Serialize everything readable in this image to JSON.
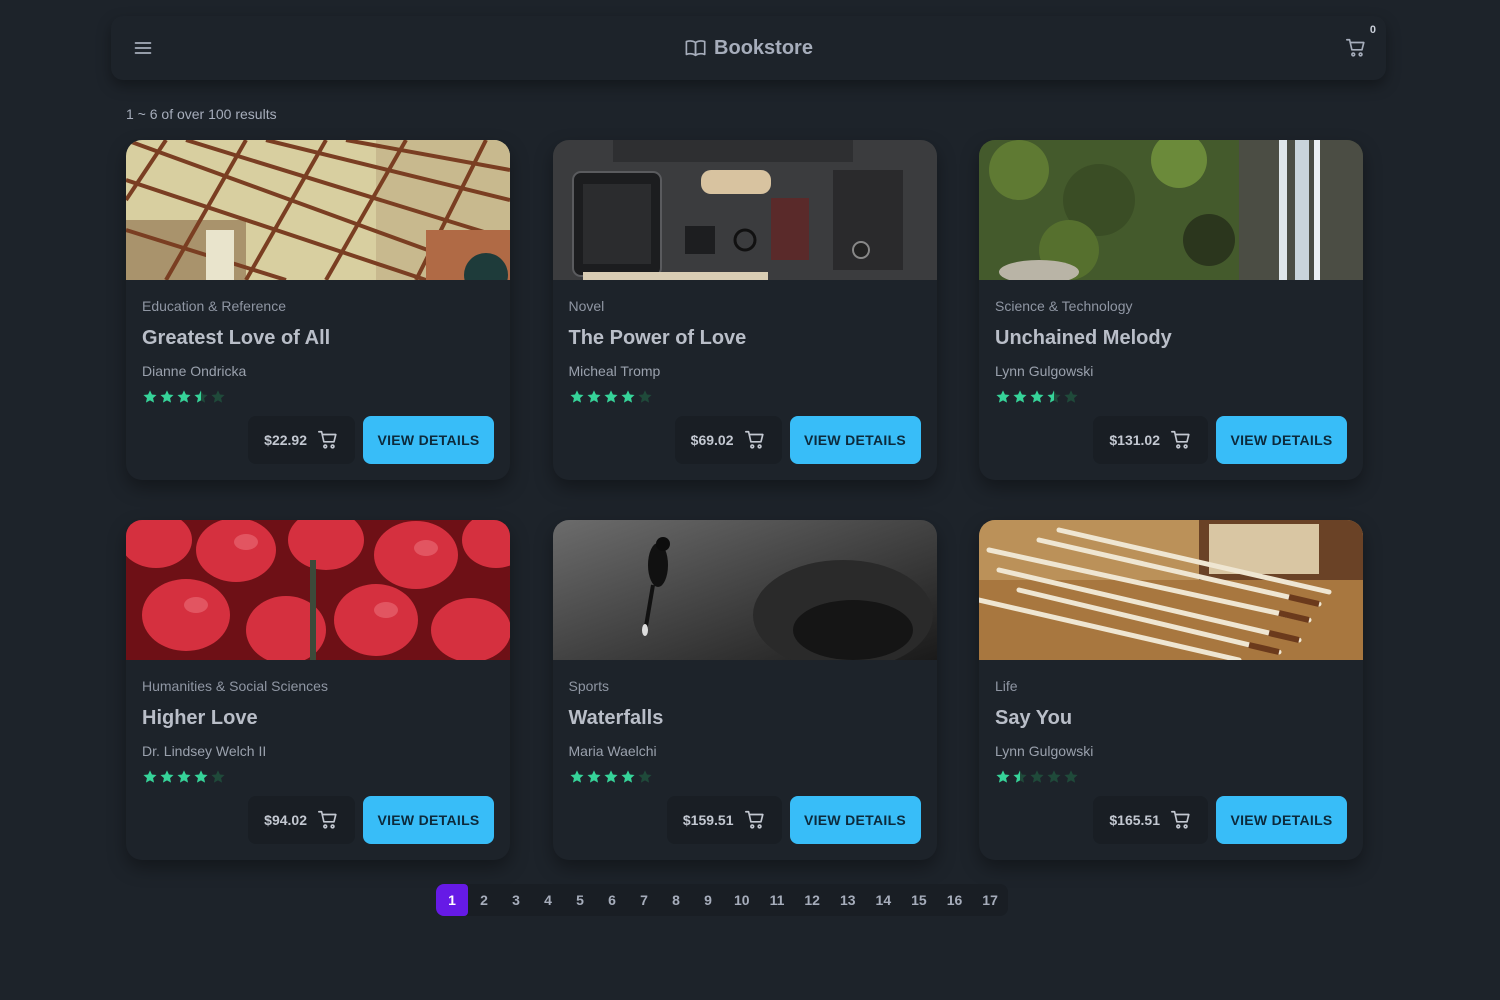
{
  "navbar": {
    "brand": "Bookstore",
    "cart_count": "0",
    "icons": {
      "menu": "hamburger-icon",
      "brand": "book-open-icon",
      "cart": "shopping-cart-icon"
    }
  },
  "results_text": "1 ~ 6 of over 100 results",
  "colors": {
    "accent": "#38bdf8",
    "star": "#36d399",
    "page_active": "#661ae6",
    "background": "#1d232a"
  },
  "books": [
    {
      "category": "Education & Reference",
      "title": "Greatest Love of All",
      "author": "Dianne Ondricka",
      "rating": 3.5,
      "price": "$22.92",
      "button": "VIEW DETAILS",
      "image": "steel-bridge-photo"
    },
    {
      "category": "Novel",
      "title": "The Power of Love",
      "author": "Micheal Tromp",
      "rating": 4,
      "price": "$69.02",
      "button": "VIEW DETAILS",
      "image": "desk-flatlay-photo"
    },
    {
      "category": "Science & Technology",
      "title": "Unchained Melody",
      "author": "Lynn Gulgowski",
      "rating": 3.5,
      "price": "$131.02",
      "button": "VIEW DETAILS",
      "image": "waterfall-photo"
    },
    {
      "category": "Humanities & Social Sciences",
      "title": "Higher Love",
      "author": "Dr. Lindsey Welch II",
      "rating": 4,
      "price": "$94.02",
      "button": "VIEW DETAILS",
      "image": "strawberries-photo"
    },
    {
      "category": "Sports",
      "title": "Waterfalls",
      "author": "Maria Waelchi",
      "rating": 4,
      "price": "$159.51",
      "button": "VIEW DETAILS",
      "image": "diver-photo"
    },
    {
      "category": "Life",
      "title": "Say You",
      "author": "Lynn Gulgowski",
      "rating": 1.5,
      "price": "$165.51",
      "button": "VIEW DETAILS",
      "image": "pencils-photo"
    }
  ],
  "pagination": {
    "current": "1",
    "pages": [
      "1",
      "2",
      "3",
      "4",
      "5",
      "6",
      "7",
      "8",
      "9",
      "10",
      "11",
      "12",
      "13",
      "14",
      "15",
      "16",
      "17"
    ]
  }
}
